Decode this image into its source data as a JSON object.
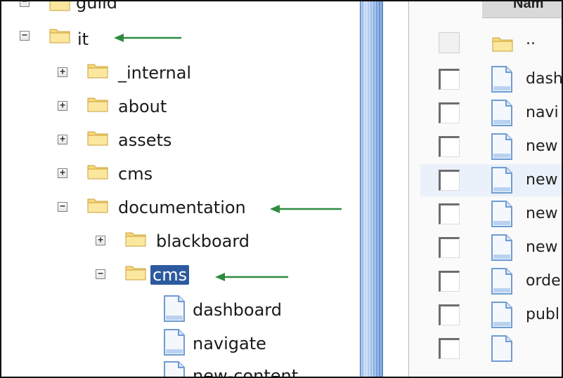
{
  "tree": {
    "nodes": [
      {
        "label": "guild",
        "expander": "−"
      },
      {
        "label": "it",
        "expander": "−"
      },
      {
        "label": "_internal",
        "expander": "+"
      },
      {
        "label": "about",
        "expander": "+"
      },
      {
        "label": "assets",
        "expander": "+"
      },
      {
        "label": "cms",
        "expander": "+"
      },
      {
        "label": "documentation",
        "expander": "−"
      },
      {
        "label": "blackboard",
        "expander": "+"
      },
      {
        "label": "cms",
        "expander": "−",
        "selected": true
      },
      {
        "label": "dashboard"
      },
      {
        "label": "navigate"
      },
      {
        "label": "new-content"
      }
    ]
  },
  "file_list": {
    "header_label": "Nam",
    "rows": [
      {
        "name": ".."
      },
      {
        "name": "dash"
      },
      {
        "name": "navi"
      },
      {
        "name": "new"
      },
      {
        "name": "new"
      },
      {
        "name": "new"
      },
      {
        "name": "new"
      },
      {
        "name": "orde"
      },
      {
        "name": "publ"
      }
    ]
  },
  "colors": {
    "arrow": "#2e8b3e",
    "selection": "#2d5a9e",
    "splitter": "#7aa6e0"
  }
}
